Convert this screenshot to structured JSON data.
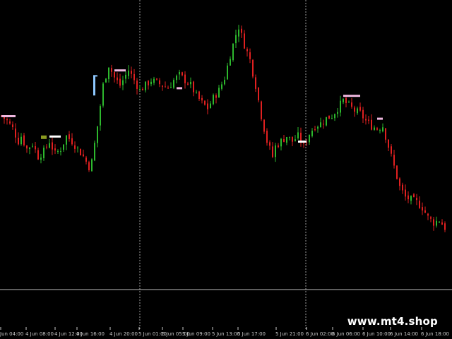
{
  "watermark": {
    "text": "www.mt4.shop"
  },
  "colors": {
    "background": "#000000",
    "bull": "#2db82d",
    "bear": "#e02020",
    "separator": "#9a9a9a",
    "axis_line": "#bdbdbd",
    "label": "#c8c8c8",
    "marker_light_blue": "#8ec8ff",
    "marker_pink": "#f0b8e0",
    "marker_olive": "#8a9a20",
    "marker_white": "#ffffff"
  },
  "chart_data": {
    "type": "candlestick",
    "x_tick_labels": [
      "Jun 04:00",
      "4 Jun 08:00",
      "4 Jun 12:00",
      "4 Jun 16:00",
      "4 Jun 20:00",
      "5 Jun 01:00",
      "5 Jun 05:00",
      "5 Jun 09:00",
      "5 Jun 13:00",
      "5 Jun 17:00",
      "5 Jun 21:00",
      "6 Jun 02:00",
      "6 Jun 06:00",
      "6 Jun 10:00",
      "6 Jun 14:00",
      "6 Jun 18:00"
    ],
    "day_separators": [
      "5 Jun 00:00",
      "6 Jun 00:00"
    ],
    "y_range": [
      0,
      100
    ],
    "close_path": [
      [
        0,
        60
      ],
      [
        2,
        58
      ],
      [
        4,
        55
      ],
      [
        6,
        50
      ],
      [
        7,
        52
      ],
      [
        9,
        47
      ],
      [
        11,
        49
      ],
      [
        13,
        44
      ],
      [
        15,
        46
      ],
      [
        17,
        50
      ],
      [
        19,
        45
      ],
      [
        21,
        47
      ],
      [
        23,
        52
      ],
      [
        25,
        50
      ],
      [
        27,
        47
      ],
      [
        29,
        44
      ],
      [
        31,
        40
      ],
      [
        32,
        42
      ],
      [
        34,
        56
      ],
      [
        36,
        72
      ],
      [
        38,
        80
      ],
      [
        40,
        75
      ],
      [
        42,
        72
      ],
      [
        44,
        76
      ],
      [
        45,
        78
      ],
      [
        47,
        74
      ],
      [
        49,
        70
      ],
      [
        51,
        72
      ],
      [
        53,
        74
      ],
      [
        55,
        73
      ],
      [
        57,
        72
      ],
      [
        59,
        71
      ],
      [
        61,
        74
      ],
      [
        63,
        76
      ],
      [
        65,
        74
      ],
      [
        67,
        72
      ],
      [
        69,
        68
      ],
      [
        71,
        65
      ],
      [
        73,
        63
      ],
      [
        75,
        67
      ],
      [
        77,
        70
      ],
      [
        79,
        75
      ],
      [
        81,
        84
      ],
      [
        83,
        92
      ],
      [
        84,
        95
      ],
      [
        86,
        88
      ],
      [
        88,
        82
      ],
      [
        90,
        72
      ],
      [
        92,
        60
      ],
      [
        94,
        50
      ],
      [
        96,
        44
      ],
      [
        97,
        48
      ],
      [
        99,
        50
      ],
      [
        101,
        52
      ],
      [
        103,
        50
      ],
      [
        105,
        52
      ],
      [
        107,
        48
      ],
      [
        109,
        53
      ],
      [
        111,
        56
      ],
      [
        113,
        57
      ],
      [
        115,
        59
      ],
      [
        117,
        60
      ],
      [
        119,
        63
      ],
      [
        121,
        66
      ],
      [
        123,
        64
      ],
      [
        125,
        62
      ],
      [
        127,
        61
      ],
      [
        129,
        58
      ],
      [
        131,
        56
      ],
      [
        133,
        55
      ],
      [
        135,
        56
      ],
      [
        137,
        48
      ],
      [
        139,
        40
      ],
      [
        141,
        32
      ],
      [
        143,
        28
      ],
      [
        145,
        27
      ],
      [
        147,
        26
      ],
      [
        149,
        24
      ],
      [
        151,
        20
      ],
      [
        153,
        18
      ],
      [
        155,
        19
      ],
      [
        157,
        16
      ]
    ],
    "level_markers": [
      {
        "color": "light_blue",
        "vertical": true,
        "value": 72,
        "at": 33
      },
      {
        "color": "pink",
        "value": 78,
        "from": 40,
        "to": 44
      },
      {
        "color": "pink",
        "value": 71,
        "from": 62,
        "to": 64
      },
      {
        "color": "pink",
        "value": 60,
        "from": 0,
        "to": 5
      },
      {
        "color": "olive",
        "value": 52,
        "from": 14,
        "to": 16
      },
      {
        "color": "white",
        "value": 52,
        "from": 17,
        "to": 21
      },
      {
        "color": "pink",
        "value": 68,
        "from": 121,
        "to": 127
      },
      {
        "color": "pink",
        "value": 59,
        "from": 133,
        "to": 135
      },
      {
        "color": "white",
        "value": 50,
        "from": 105,
        "to": 108
      }
    ]
  }
}
